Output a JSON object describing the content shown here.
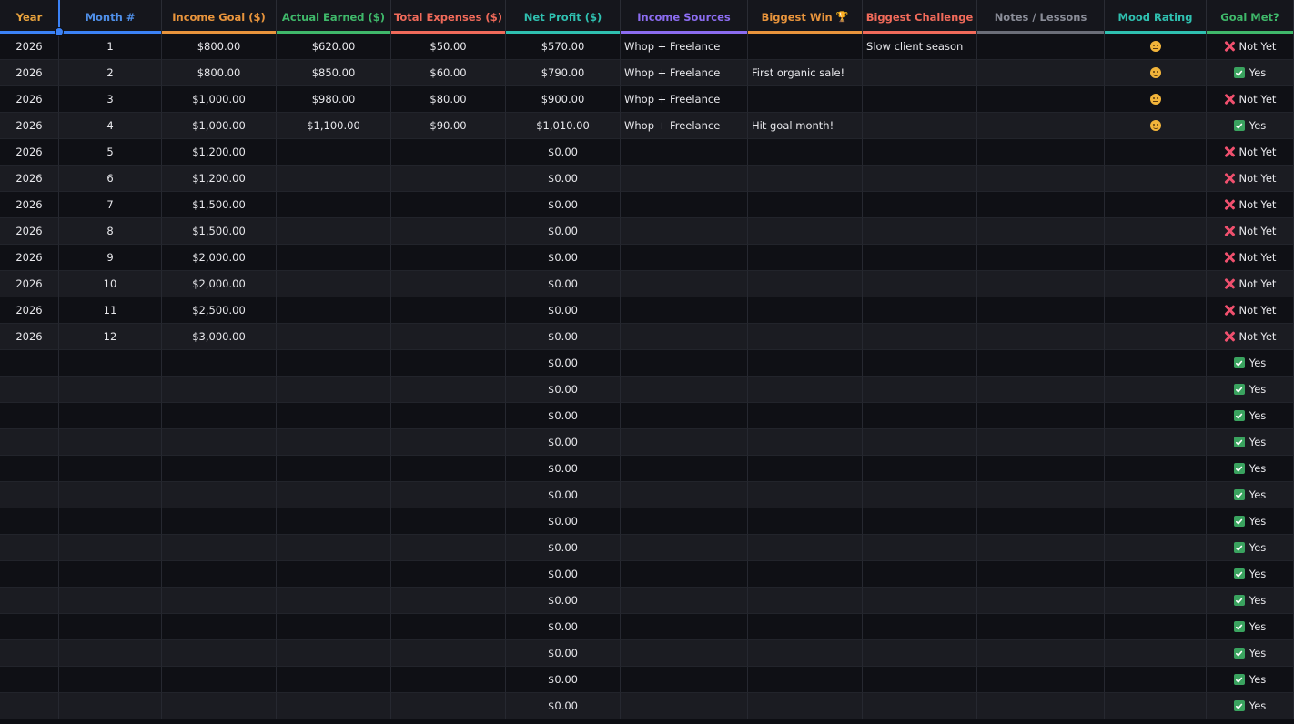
{
  "columns": [
    {
      "label": "Year",
      "color": "#e8a23c",
      "underline": "#3b82f6"
    },
    {
      "label": "Month #",
      "color": "#4f8fe8",
      "underline": "#3b82f6"
    },
    {
      "label": "Income Goal ($)",
      "color": "#e8943c",
      "underline": "#e8943c"
    },
    {
      "label": "Actual Earned ($)",
      "color": "#3fb86a",
      "underline": "#3fb86a"
    },
    {
      "label": "Total Expenses ($)",
      "color": "#f06a5a",
      "underline": "#f06a5a"
    },
    {
      "label": "Net Profit ($)",
      "color": "#2fc0b0",
      "underline": "#2fc0b0"
    },
    {
      "label": "Income Sources",
      "color": "#8b6cf0",
      "underline": "#8b6cf0"
    },
    {
      "label": "Biggest Win",
      "color": "#e8943c",
      "underline": "#e8943c",
      "icon": "trophy-icon"
    },
    {
      "label": "Biggest Challenge",
      "color": "#f06a5a",
      "underline": "#f06a5a"
    },
    {
      "label": "Notes / Lessons",
      "color": "#8a8d98",
      "underline": "#6b6e78"
    },
    {
      "label": "Mood Rating",
      "color": "#2fc0b0",
      "underline": "#2fc0b0"
    },
    {
      "label": "Goal Met?",
      "color": "#3fb86a",
      "underline": "#3fb86a"
    }
  ],
  "rows": [
    {
      "year": "2026",
      "month": "1",
      "goal": "$800.00",
      "earned": "$620.00",
      "expenses": "$50.00",
      "net": "$570.00",
      "sources": "Whop + Freelance",
      "win": "",
      "challenge": "Slow client season",
      "notes": "",
      "mood": "neutral",
      "met": "no",
      "met_label": "Not Yet"
    },
    {
      "year": "2026",
      "month": "2",
      "goal": "$800.00",
      "earned": "$850.00",
      "expenses": "$60.00",
      "net": "$790.00",
      "sources": "Whop + Freelance",
      "win": "First organic sale!",
      "challenge": "",
      "notes": "",
      "mood": "happy",
      "met": "yes",
      "met_label": "Yes"
    },
    {
      "year": "2026",
      "month": "3",
      "goal": "$1,000.00",
      "earned": "$980.00",
      "expenses": "$80.00",
      "net": "$900.00",
      "sources": "Whop + Freelance",
      "win": "",
      "challenge": "",
      "notes": "",
      "mood": "neutral",
      "met": "no",
      "met_label": "Not Yet"
    },
    {
      "year": "2026",
      "month": "4",
      "goal": "$1,000.00",
      "earned": "$1,100.00",
      "expenses": "$90.00",
      "net": "$1,010.00",
      "sources": "Whop + Freelance",
      "win": "Hit goal month!",
      "challenge": "",
      "notes": "",
      "mood": "happy",
      "met": "yes",
      "met_label": "Yes"
    },
    {
      "year": "2026",
      "month": "5",
      "goal": "$1,200.00",
      "earned": "",
      "expenses": "",
      "net": "$0.00",
      "sources": "",
      "win": "",
      "challenge": "",
      "notes": "",
      "mood": "",
      "met": "no",
      "met_label": "Not Yet"
    },
    {
      "year": "2026",
      "month": "6",
      "goal": "$1,200.00",
      "earned": "",
      "expenses": "",
      "net": "$0.00",
      "sources": "",
      "win": "",
      "challenge": "",
      "notes": "",
      "mood": "",
      "met": "no",
      "met_label": "Not Yet"
    },
    {
      "year": "2026",
      "month": "7",
      "goal": "$1,500.00",
      "earned": "",
      "expenses": "",
      "net": "$0.00",
      "sources": "",
      "win": "",
      "challenge": "",
      "notes": "",
      "mood": "",
      "met": "no",
      "met_label": "Not Yet"
    },
    {
      "year": "2026",
      "month": "8",
      "goal": "$1,500.00",
      "earned": "",
      "expenses": "",
      "net": "$0.00",
      "sources": "",
      "win": "",
      "challenge": "",
      "notes": "",
      "mood": "",
      "met": "no",
      "met_label": "Not Yet"
    },
    {
      "year": "2026",
      "month": "9",
      "goal": "$2,000.00",
      "earned": "",
      "expenses": "",
      "net": "$0.00",
      "sources": "",
      "win": "",
      "challenge": "",
      "notes": "",
      "mood": "",
      "met": "no",
      "met_label": "Not Yet"
    },
    {
      "year": "2026",
      "month": "10",
      "goal": "$2,000.00",
      "earned": "",
      "expenses": "",
      "net": "$0.00",
      "sources": "",
      "win": "",
      "challenge": "",
      "notes": "",
      "mood": "",
      "met": "no",
      "met_label": "Not Yet"
    },
    {
      "year": "2026",
      "month": "11",
      "goal": "$2,500.00",
      "earned": "",
      "expenses": "",
      "net": "$0.00",
      "sources": "",
      "win": "",
      "challenge": "",
      "notes": "",
      "mood": "",
      "met": "no",
      "met_label": "Not Yet"
    },
    {
      "year": "2026",
      "month": "12",
      "goal": "$3,000.00",
      "earned": "",
      "expenses": "",
      "net": "$0.00",
      "sources": "",
      "win": "",
      "challenge": "",
      "notes": "",
      "mood": "",
      "met": "no",
      "met_label": "Not Yet"
    },
    {
      "year": "",
      "month": "",
      "goal": "",
      "earned": "",
      "expenses": "",
      "net": "$0.00",
      "sources": "",
      "win": "",
      "challenge": "",
      "notes": "",
      "mood": "",
      "met": "yes",
      "met_label": "Yes"
    },
    {
      "year": "",
      "month": "",
      "goal": "",
      "earned": "",
      "expenses": "",
      "net": "$0.00",
      "sources": "",
      "win": "",
      "challenge": "",
      "notes": "",
      "mood": "",
      "met": "yes",
      "met_label": "Yes"
    },
    {
      "year": "",
      "month": "",
      "goal": "",
      "earned": "",
      "expenses": "",
      "net": "$0.00",
      "sources": "",
      "win": "",
      "challenge": "",
      "notes": "",
      "mood": "",
      "met": "yes",
      "met_label": "Yes"
    },
    {
      "year": "",
      "month": "",
      "goal": "",
      "earned": "",
      "expenses": "",
      "net": "$0.00",
      "sources": "",
      "win": "",
      "challenge": "",
      "notes": "",
      "mood": "",
      "met": "yes",
      "met_label": "Yes"
    },
    {
      "year": "",
      "month": "",
      "goal": "",
      "earned": "",
      "expenses": "",
      "net": "$0.00",
      "sources": "",
      "win": "",
      "challenge": "",
      "notes": "",
      "mood": "",
      "met": "yes",
      "met_label": "Yes"
    },
    {
      "year": "",
      "month": "",
      "goal": "",
      "earned": "",
      "expenses": "",
      "net": "$0.00",
      "sources": "",
      "win": "",
      "challenge": "",
      "notes": "",
      "mood": "",
      "met": "yes",
      "met_label": "Yes"
    },
    {
      "year": "",
      "month": "",
      "goal": "",
      "earned": "",
      "expenses": "",
      "net": "$0.00",
      "sources": "",
      "win": "",
      "challenge": "",
      "notes": "",
      "mood": "",
      "met": "yes",
      "met_label": "Yes"
    },
    {
      "year": "",
      "month": "",
      "goal": "",
      "earned": "",
      "expenses": "",
      "net": "$0.00",
      "sources": "",
      "win": "",
      "challenge": "",
      "notes": "",
      "mood": "",
      "met": "yes",
      "met_label": "Yes"
    },
    {
      "year": "",
      "month": "",
      "goal": "",
      "earned": "",
      "expenses": "",
      "net": "$0.00",
      "sources": "",
      "win": "",
      "challenge": "",
      "notes": "",
      "mood": "",
      "met": "yes",
      "met_label": "Yes"
    },
    {
      "year": "",
      "month": "",
      "goal": "",
      "earned": "",
      "expenses": "",
      "net": "$0.00",
      "sources": "",
      "win": "",
      "challenge": "",
      "notes": "",
      "mood": "",
      "met": "yes",
      "met_label": "Yes"
    },
    {
      "year": "",
      "month": "",
      "goal": "",
      "earned": "",
      "expenses": "",
      "net": "$0.00",
      "sources": "",
      "win": "",
      "challenge": "",
      "notes": "",
      "mood": "",
      "met": "yes",
      "met_label": "Yes"
    },
    {
      "year": "",
      "month": "",
      "goal": "",
      "earned": "",
      "expenses": "",
      "net": "$0.00",
      "sources": "",
      "win": "",
      "challenge": "",
      "notes": "",
      "mood": "",
      "met": "yes",
      "met_label": "Yes"
    },
    {
      "year": "",
      "month": "",
      "goal": "",
      "earned": "",
      "expenses": "",
      "net": "$0.00",
      "sources": "",
      "win": "",
      "challenge": "",
      "notes": "",
      "mood": "",
      "met": "yes",
      "met_label": "Yes"
    },
    {
      "year": "",
      "month": "",
      "goal": "",
      "earned": "",
      "expenses": "",
      "net": "$0.00",
      "sources": "",
      "win": "",
      "challenge": "",
      "notes": "",
      "mood": "",
      "met": "yes",
      "met_label": "Yes"
    }
  ]
}
